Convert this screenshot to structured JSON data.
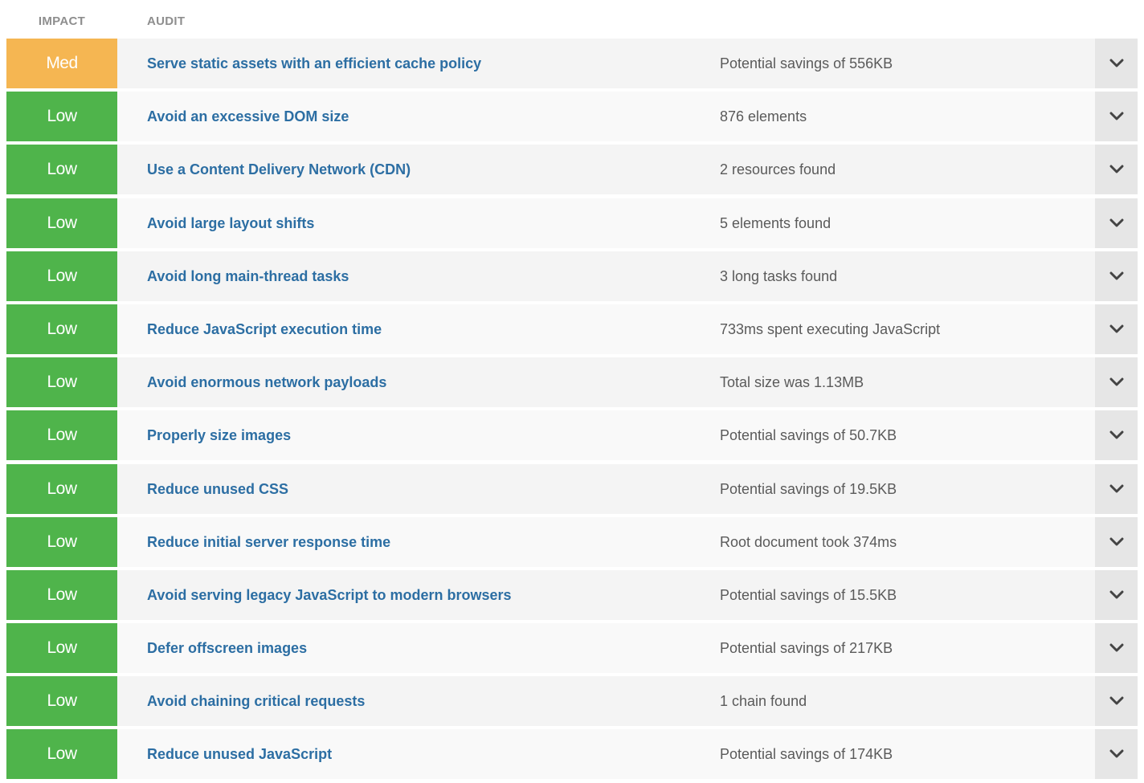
{
  "header": {
    "impact_label": "IMPACT",
    "audit_label": "AUDIT"
  },
  "colors": {
    "med": "#f5b652",
    "low": "#4fb44b",
    "audit_link": "#2c6ea3",
    "detail_text": "#5a5a5a"
  },
  "icons": {
    "expand": "chevron-down-icon"
  },
  "audits": [
    {
      "impact": "Med",
      "level": "med",
      "title": "Serve static assets with an efficient cache policy",
      "detail": "Potential savings of 556KB"
    },
    {
      "impact": "Low",
      "level": "low",
      "title": "Avoid an excessive DOM size",
      "detail": "876 elements"
    },
    {
      "impact": "Low",
      "level": "low",
      "title": "Use a Content Delivery Network (CDN)",
      "detail": "2 resources found"
    },
    {
      "impact": "Low",
      "level": "low",
      "title": "Avoid large layout shifts",
      "detail": "5 elements found"
    },
    {
      "impact": "Low",
      "level": "low",
      "title": "Avoid long main-thread tasks",
      "detail": "3 long tasks found"
    },
    {
      "impact": "Low",
      "level": "low",
      "title": "Reduce JavaScript execution time",
      "detail": "733ms spent executing JavaScript"
    },
    {
      "impact": "Low",
      "level": "low",
      "title": "Avoid enormous network payloads",
      "detail": "Total size was 1.13MB"
    },
    {
      "impact": "Low",
      "level": "low",
      "title": "Properly size images",
      "detail": "Potential savings of 50.7KB"
    },
    {
      "impact": "Low",
      "level": "low",
      "title": "Reduce unused CSS",
      "detail": "Potential savings of 19.5KB"
    },
    {
      "impact": "Low",
      "level": "low",
      "title": "Reduce initial server response time",
      "detail": "Root document took 374ms"
    },
    {
      "impact": "Low",
      "level": "low",
      "title": "Avoid serving legacy JavaScript to modern browsers",
      "detail": "Potential savings of 15.5KB"
    },
    {
      "impact": "Low",
      "level": "low",
      "title": "Defer offscreen images",
      "detail": "Potential savings of 217KB"
    },
    {
      "impact": "Low",
      "level": "low",
      "title": "Avoid chaining critical requests",
      "detail": "1 chain found"
    },
    {
      "impact": "Low",
      "level": "low",
      "title": "Reduce unused JavaScript",
      "detail": "Potential savings of 174KB"
    }
  ]
}
